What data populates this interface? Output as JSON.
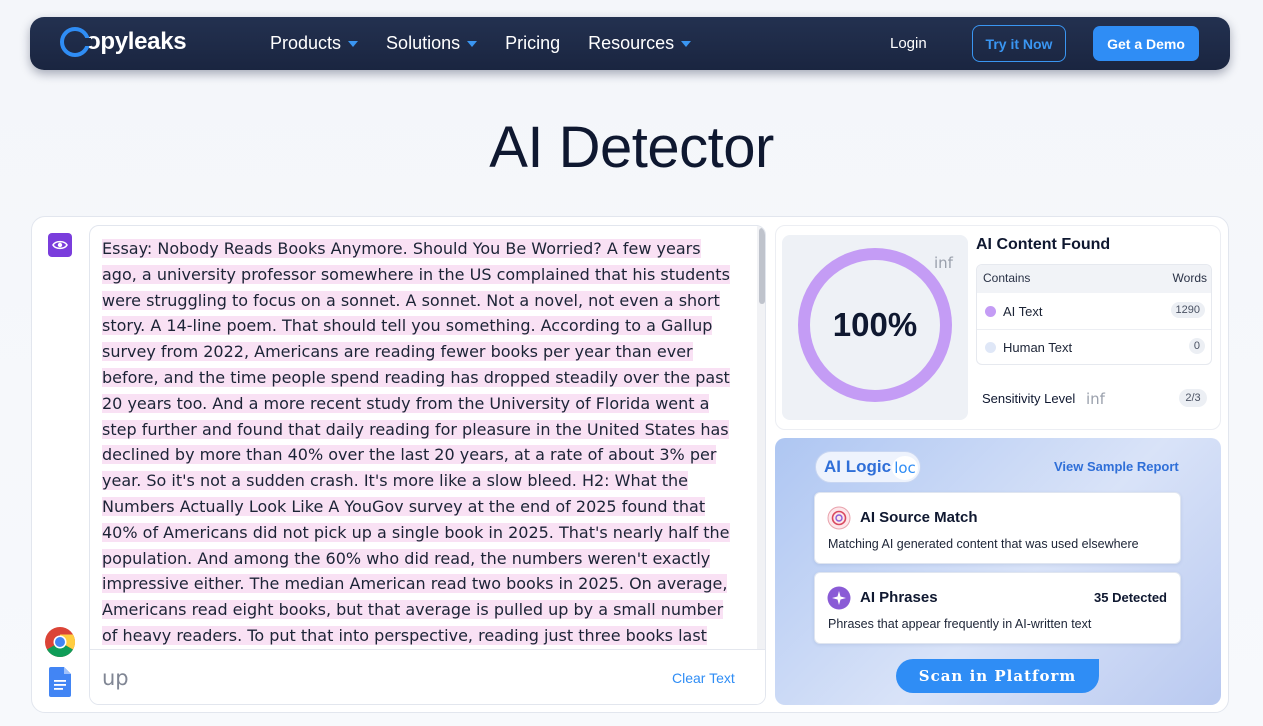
{
  "nav": {
    "brand": "Copyleaks",
    "brand_text": "opyleaks",
    "items": [
      {
        "label": "Products",
        "has_dropdown": true
      },
      {
        "label": "Solutions",
        "has_dropdown": true
      },
      {
        "label": "Pricing",
        "has_dropdown": false
      },
      {
        "label": "Resources",
        "has_dropdown": true
      }
    ],
    "login": "Login",
    "try_now": "Try it Now",
    "get_demo": "Get a Demo"
  },
  "page_title": "AI Detector",
  "editor": {
    "essay_text": "Essay: Nobody Reads Books Anymore. Should You Be Worried? A few years ago, a university professor somewhere in the US complained that his students were struggling to focus on a sonnet. A sonnet. Not a novel, not even a short story. A 14-line poem. That should tell you something. According to a Gallup survey from 2022, Americans are reading fewer books per year than ever before, and the time people spend reading has dropped steadily over the past 20 years too. And a more recent study from the University of Florida went a step further and found that daily reading for pleasure in the United States has declined by more than 40% over the last 20 years, at a rate of about 3% per year. So it's not a sudden crash. It's more like a slow bleed. H2: What the Numbers Actually Look Like A YouGov survey at the end of 2025 found that 40% of Americans did not pick up a single book in 2025. That's nearly half the population. And among the 60% who did read, the numbers weren't exactly impressive either. The median American read two books in 2025. On average, Americans read eight books, but that average is pulled up by a small number of heavy readers. To put that into perspective, reading just three books last year puts you ahead of more than half of all American adults. Reading ten books",
    "upload_label": "up",
    "clear_text": "Clear Text"
  },
  "results": {
    "ai_percent": "100%",
    "info_icon_text": "inf",
    "title": "AI Content Found",
    "table_headers": {
      "contains": "Contains",
      "words": "Words"
    },
    "rows": [
      {
        "label": "AI Text",
        "count": "1290",
        "color": "#c49cf5"
      },
      {
        "label": "Human Text",
        "count": "0",
        "color": "#dfe7f7"
      }
    ],
    "sensitivity_label": "Sensitivity Level",
    "sensitivity_info": "inf",
    "sensitivity_value": "2/3"
  },
  "ai_logic": {
    "tag_label": "AI Logic",
    "tag_icon_text": "loc",
    "view_sample": "View Sample Report",
    "features": [
      {
        "title": "AI Source Match",
        "description": "Matching AI generated content that was used elsewhere",
        "count": ""
      },
      {
        "title": "AI Phrases",
        "description": "Phrases that appear frequently in AI-written text",
        "count": "35 Detected"
      }
    ],
    "scan_button": "Scan in Platform"
  },
  "colors": {
    "accent": "#2f8df5",
    "navbar": "#1e2b48",
    "ai_purple": "#c49cf5",
    "highlight": "#f9e1f4"
  }
}
